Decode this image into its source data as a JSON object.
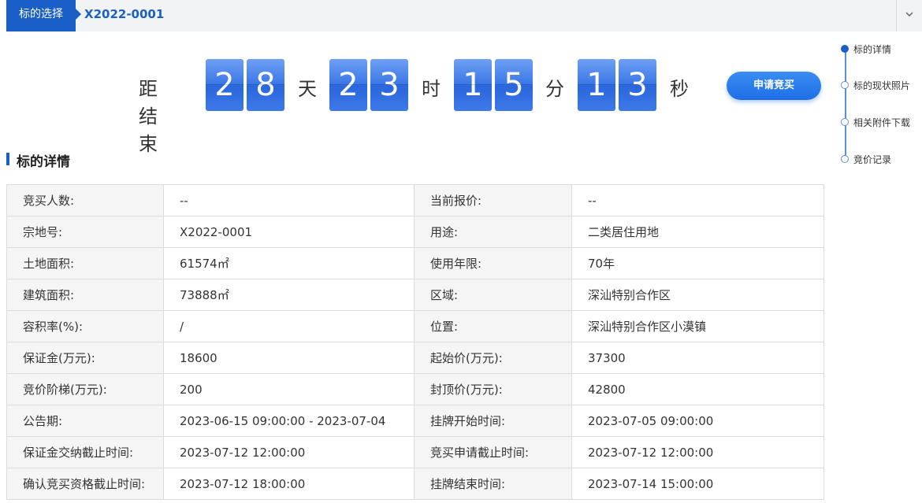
{
  "breadcrumb": {
    "tab_label": "标的选择",
    "id": "X2022-0001"
  },
  "countdown": {
    "prefix": "距结束",
    "days": [
      "2",
      "8"
    ],
    "days_unit": "天",
    "hours": [
      "2",
      "3"
    ],
    "hours_unit": "时",
    "minutes": [
      "1",
      "5"
    ],
    "minutes_unit": "分",
    "seconds": [
      "1",
      "3"
    ],
    "seconds_unit": "秒"
  },
  "apply_button": "申请竞买",
  "side_nav": {
    "items": [
      {
        "label": "标的详情",
        "active": true
      },
      {
        "label": "标的现状照片",
        "active": false
      },
      {
        "label": "相关附件下载",
        "active": false
      },
      {
        "label": "竞价记录",
        "active": false
      }
    ]
  },
  "section_title": "标的详情",
  "details": {
    "rows": [
      [
        "竞买人数:",
        "--",
        "当前报价:",
        "--"
      ],
      [
        "宗地号:",
        "X2022-0001",
        "用途:",
        "二类居住用地"
      ],
      [
        "土地面积:",
        "61574㎡",
        "使用年限:",
        "70年"
      ],
      [
        "建筑面积:",
        "73888㎡",
        "区域:",
        "深汕特别合作区"
      ],
      [
        "容积率(%):",
        "/",
        "位置:",
        "深汕特别合作区小漠镇"
      ],
      [
        "保证金(万元):",
        "18600",
        "起始价(万元):",
        "37300"
      ],
      [
        "竞价阶梯(万元):",
        "200",
        "封顶价(万元):",
        "42800"
      ],
      [
        "公告期:",
        "2023-06-15 09:00:00 - 2023-07-04",
        "挂牌开始时间:",
        "2023-07-05 09:00:00"
      ],
      [
        "保证金交纳截止时间:",
        "2023-07-12 12:00:00",
        "竞买申请截止时间:",
        "2023-07-12 12:00:00"
      ],
      [
        "确认竞买资格截止时间:",
        "2023-07-12 18:00:00",
        "挂牌结束时间:",
        "2023-07-14 15:00:00"
      ]
    ]
  },
  "colors": {
    "accent": "#1a5fc8",
    "digit": "#3b77e6"
  },
  "icons": {
    "collapse": "chevron-down-icon"
  }
}
